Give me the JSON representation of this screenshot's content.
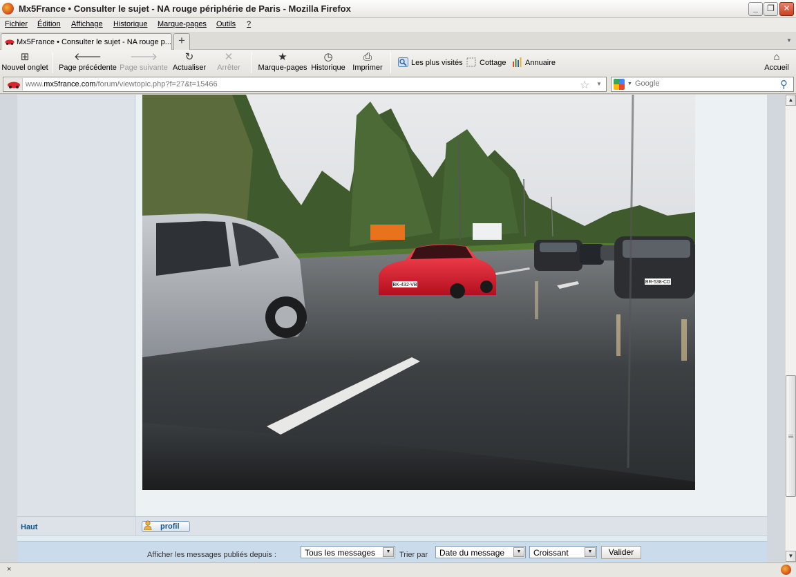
{
  "window": {
    "title": "Mx5France • Consulter le sujet - NA rouge périphérie de Paris - Mozilla Firefox",
    "min": "_",
    "max": "❐",
    "close": "✕"
  },
  "menu": [
    "Fichier",
    "Édition",
    "Affichage",
    "Historique",
    "Marque-pages",
    "Outils",
    "?"
  ],
  "tab": {
    "label": "Mx5France • Consulter le sujet - NA rouge p...",
    "newtab": "+"
  },
  "toolbar": {
    "new_tab": "Nouvel onglet",
    "back": "Page précédente",
    "forward": "Page suivante",
    "reload": "Actualiser",
    "stop": "Arrêter",
    "bookmarks": "Marque-pages",
    "history": "Historique",
    "print": "Imprimer",
    "home": "Accueil"
  },
  "bookmarks_bar": [
    "Les plus visités",
    "Cottage",
    "Annuaire"
  ],
  "url": {
    "prefix": "www.",
    "domain": "mx5france.com",
    "path": "/forum/viewtopic.php?f=27&t=15466"
  },
  "search": {
    "placeholder": "Google"
  },
  "post": {
    "top_link": "Haut",
    "profile_button": "profil",
    "plates": [
      "BK-432-VB",
      "BR-538-CD"
    ]
  },
  "sortbar": {
    "show_label": "Afficher les messages publiés depuis :",
    "show_value": "Tous les messages",
    "sort_label": "Trier par",
    "sort_value": "Date du message",
    "order_value": "Croissant",
    "submit": "Valider"
  },
  "status": {
    "text": "×"
  },
  "colors": {
    "link": "#105289",
    "page_bg": "#e1ebf2",
    "car": "#d5172b"
  }
}
